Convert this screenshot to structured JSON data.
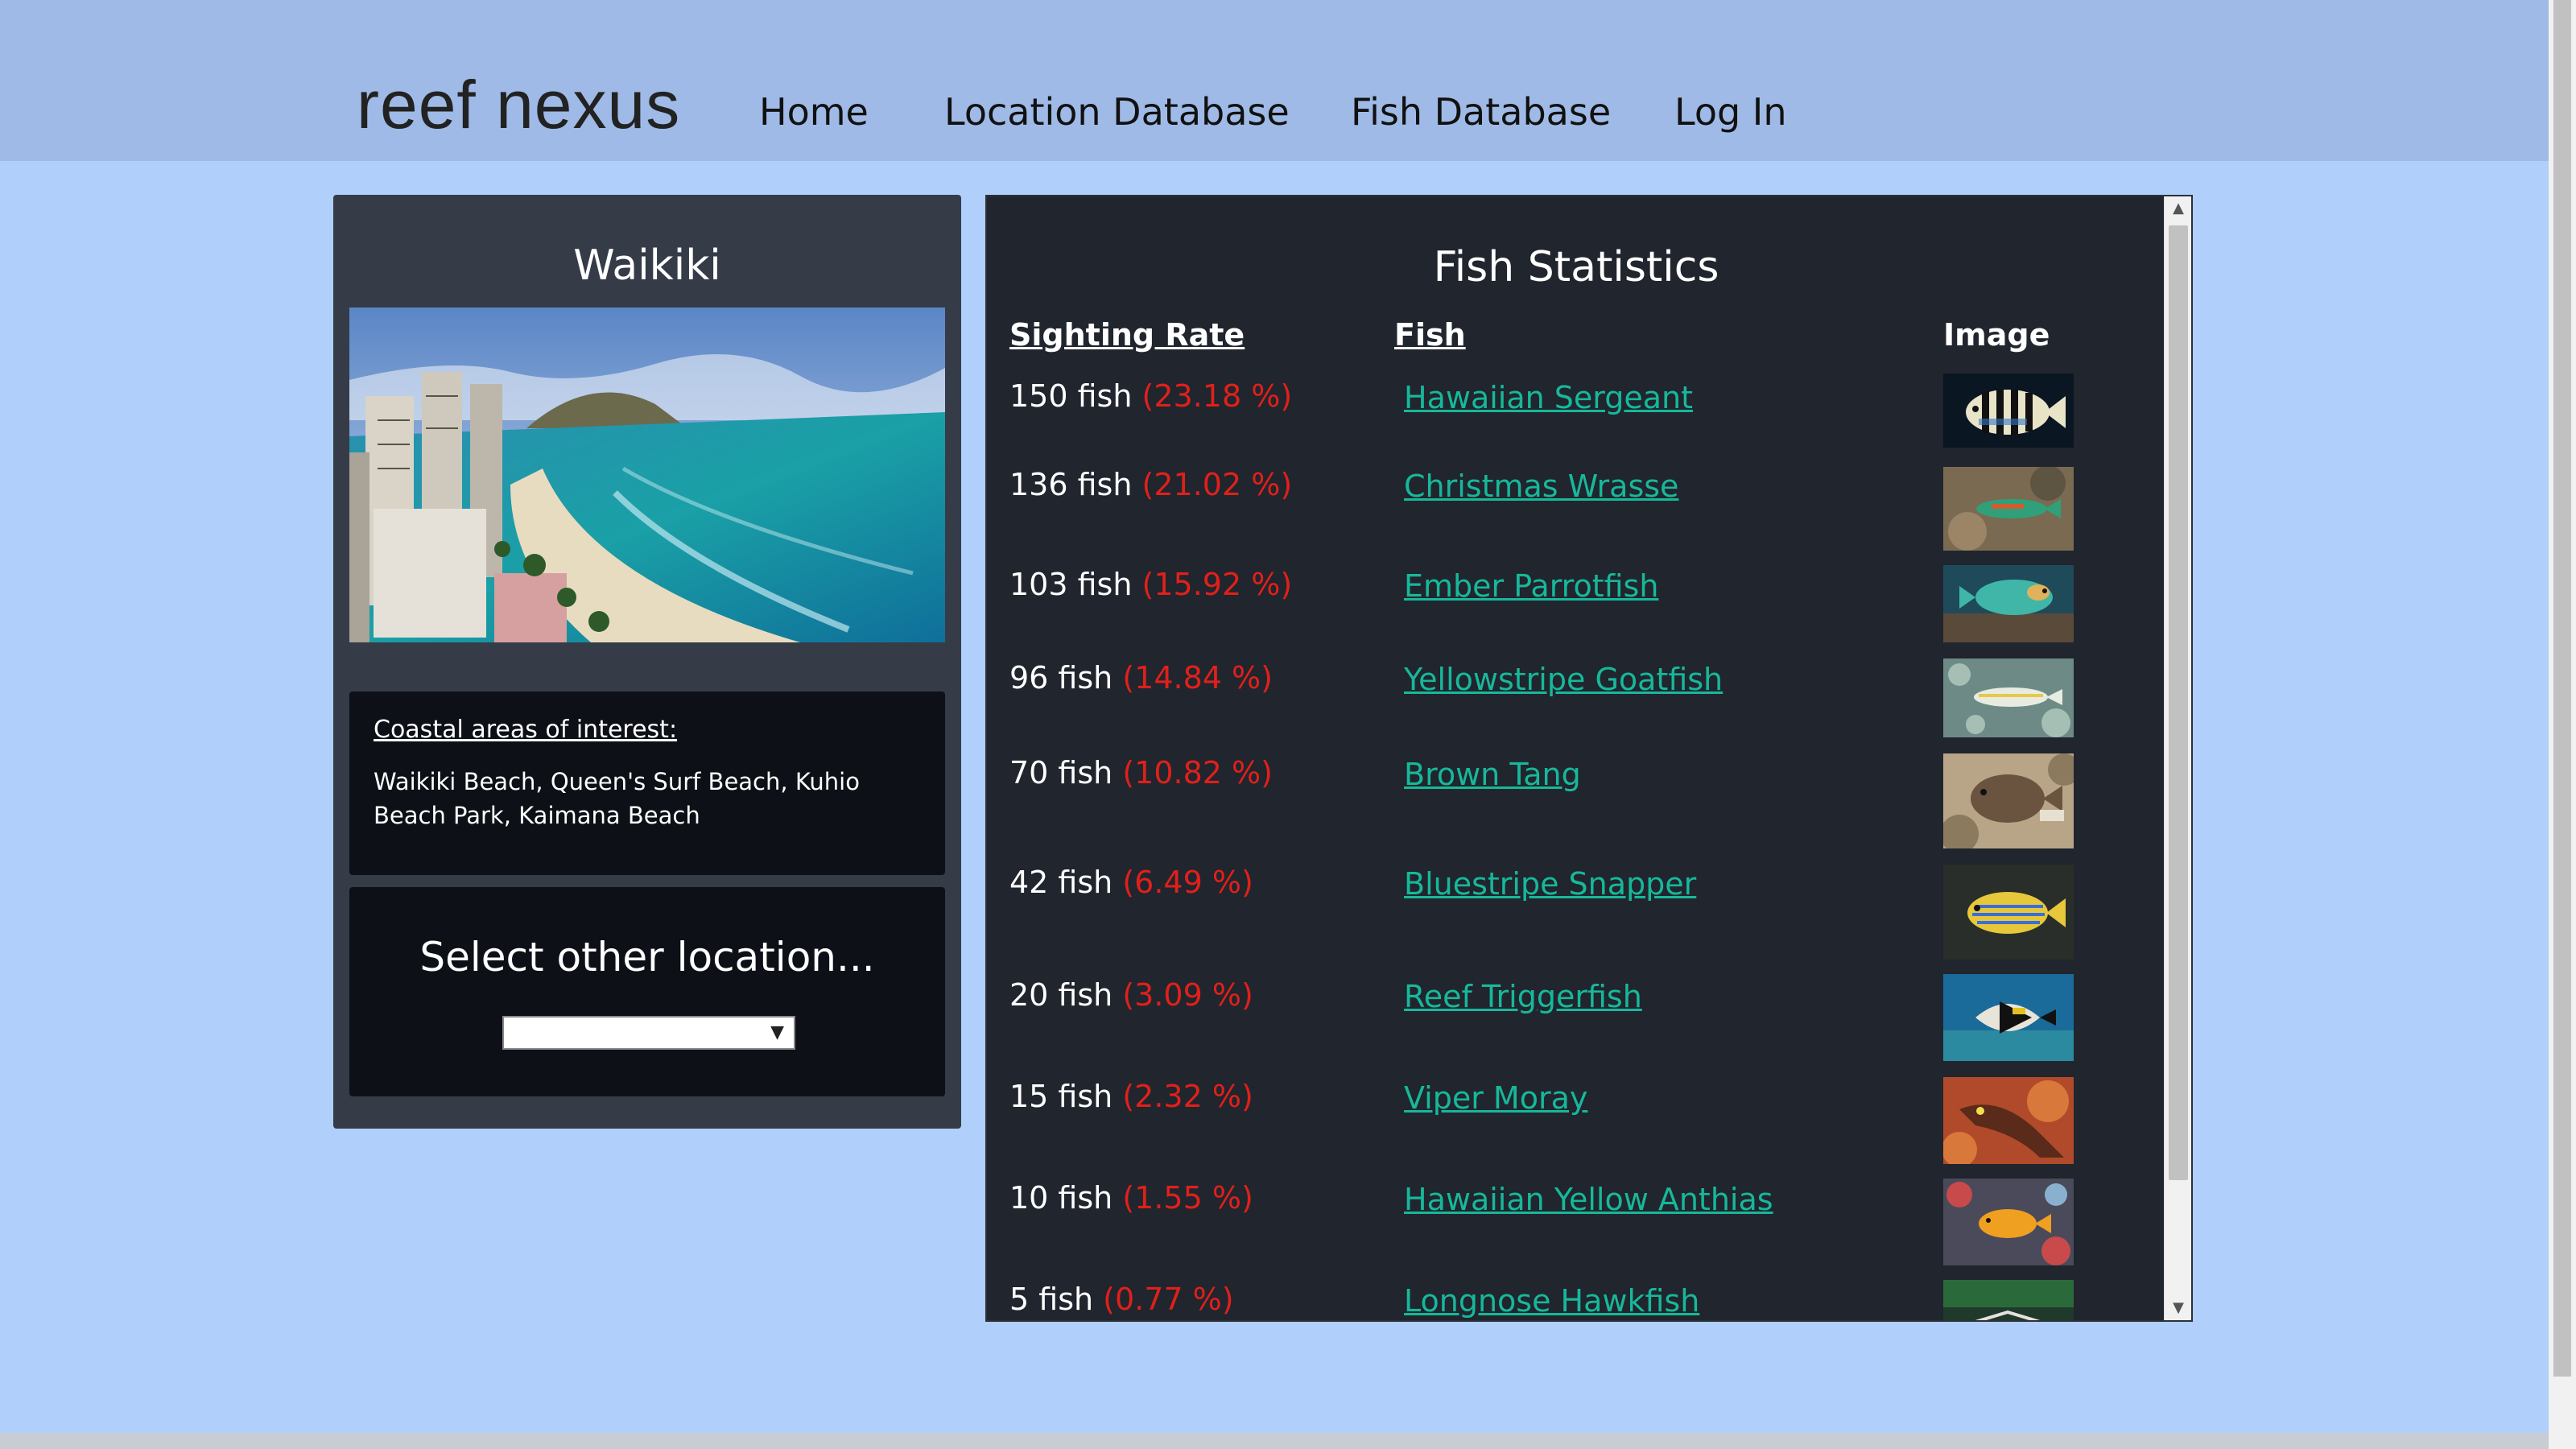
{
  "header": {
    "logo": "reef nexus",
    "nav": [
      "Home",
      "Location Database",
      "Fish Database",
      "Log In"
    ]
  },
  "location": {
    "title": "Waikiki",
    "coastal_heading": "Coastal areas of interest:",
    "coastal_text": "Waikiki Beach, Queen's Surf Beach, Kuhio Beach Park, Kaimana Beach",
    "select_title": "Select other location...",
    "select_value": ""
  },
  "stats": {
    "title": "Fish Statistics",
    "headers": {
      "rate": "Sighting Rate",
      "fish": "Fish",
      "image": "Image"
    },
    "rows": [
      {
        "count": "150 fish",
        "pct": "(23.18 %)",
        "fish": "Hawaiian Sergeant",
        "image": "hawaiian-sergeant-photo"
      },
      {
        "count": "136 fish",
        "pct": "(21.02 %)",
        "fish": "Christmas Wrasse",
        "image": "christmas-wrasse-photo"
      },
      {
        "count": "103 fish",
        "pct": "(15.92 %)",
        "fish": "Ember Parrotfish",
        "image": "ember-parrotfish-photo"
      },
      {
        "count": "96 fish",
        "pct": "(14.84 %)",
        "fish": "Yellowstripe Goatfish",
        "image": "yellowstripe-goatfish-photo"
      },
      {
        "count": "70 fish",
        "pct": "(10.82 %)",
        "fish": "Brown Tang",
        "image": "brown-tang-photo"
      },
      {
        "count": "42 fish",
        "pct": "(6.49 %)",
        "fish": "Bluestripe Snapper",
        "image": "bluestripe-snapper-photo"
      },
      {
        "count": "20 fish",
        "pct": "(3.09 %)",
        "fish": "Reef Triggerfish",
        "image": "reef-triggerfish-photo"
      },
      {
        "count": "15 fish",
        "pct": "(2.32 %)",
        "fish": "Viper Moray",
        "image": "viper-moray-photo"
      },
      {
        "count": "10 fish",
        "pct": "(1.55 %)",
        "fish": "Hawaiian Yellow Anthias",
        "image": "hawaiian-yellow-anthias-photo"
      },
      {
        "count": "5 fish",
        "pct": "(0.77 %)",
        "fish": "Longnose Hawkfish",
        "image": "longnose-hawkfish-photo"
      }
    ]
  },
  "colors": {
    "link": "#17b89a",
    "percent": "#e0201a",
    "page_bg": "#b0cffb",
    "header_bg": "#9fbae6"
  }
}
